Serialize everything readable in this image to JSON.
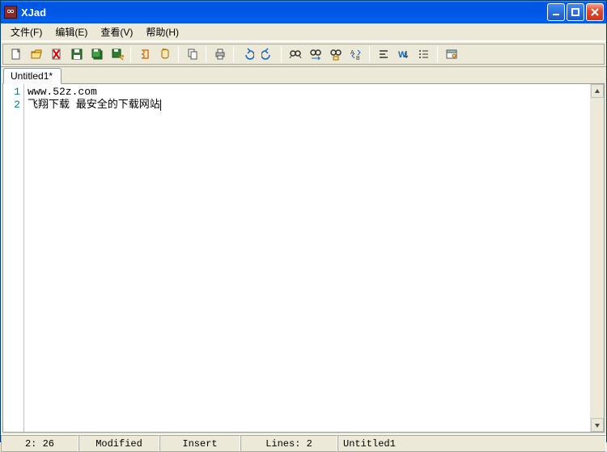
{
  "window": {
    "title": "XJad"
  },
  "menu": {
    "file": "文件(F)",
    "edit": "编辑(E)",
    "view": "查看(V)",
    "help": "帮助(H)"
  },
  "toolbar": {
    "new": "new",
    "open": "open",
    "close": "close",
    "save": "save",
    "saveall": "saveall",
    "saveas": "saveas",
    "jadclass": "jadclass",
    "jadjar": "jadjar",
    "copy": "copy",
    "print": "print",
    "undo": "undo",
    "redo": "redo",
    "find": "find",
    "findnext": "findnext",
    "findclass": "findclass",
    "replace": "replace",
    "indent": "indent",
    "wrap": "wrap",
    "list": "list",
    "options": "options"
  },
  "tab": {
    "label": "Untitled1*"
  },
  "editor": {
    "lines": [
      {
        "num": "1",
        "text": "www.52z.com"
      },
      {
        "num": "2",
        "text": "飞翔下载 最安全的下载网站"
      }
    ]
  },
  "status": {
    "pos": "2: 26",
    "modified": "Modified",
    "insert": "Insert",
    "lines": "Lines: 2",
    "name": "Untitled1"
  }
}
